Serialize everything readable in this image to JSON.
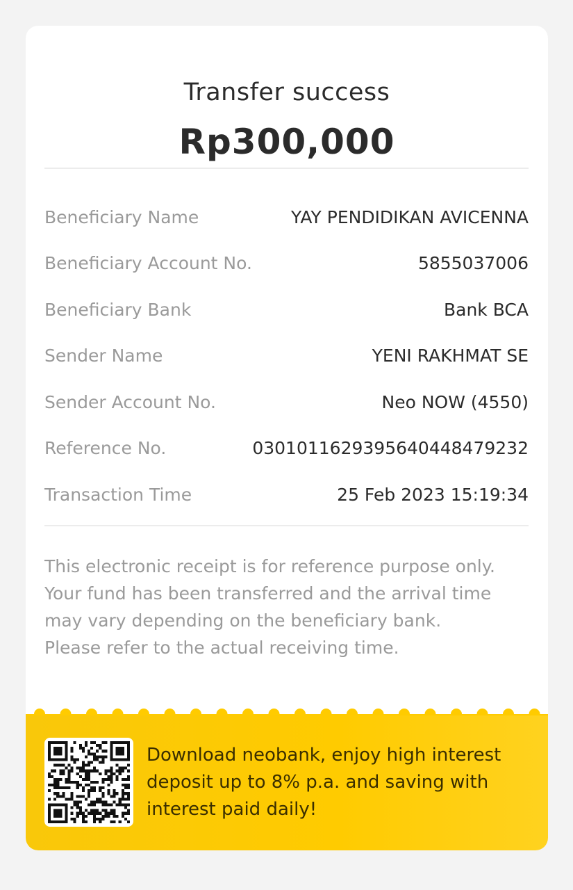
{
  "header": {
    "title": "Transfer success",
    "amount": "Rp300,000"
  },
  "details": [
    {
      "label": "Beneficiary Name",
      "value": "YAY PENDIDIKAN AVICENNA"
    },
    {
      "label": "Beneficiary Account No.",
      "value": "5855037006"
    },
    {
      "label": "Beneficiary Bank",
      "value": "Bank BCA"
    },
    {
      "label": "Sender Name",
      "value": "YENI RAKHMAT SE"
    },
    {
      "label": "Sender Account No.",
      "value": "Neo NOW (4550)"
    },
    {
      "label": "Reference No.",
      "value": "0301011629395640448479232"
    },
    {
      "label": "Transaction Time",
      "value": "25 Feb 2023 15:19:34"
    }
  ],
  "notice": "This electronic receipt is for reference purpose only. Your fund has been transferred and the arrival time may vary depending on the beneficiary bank. Please refer to the actual receiving time.",
  "promo": {
    "qr_icon": "qr-code-icon",
    "text": "Download neobank, enjoy high interest deposit up to 8% p.a. and saving with interest paid daily!"
  },
  "colors": {
    "background": "#f3f3f3",
    "card": "#ffffff",
    "banner": "#ffcb00",
    "label": "#9a9a9a",
    "value": "#2b2b2b"
  }
}
